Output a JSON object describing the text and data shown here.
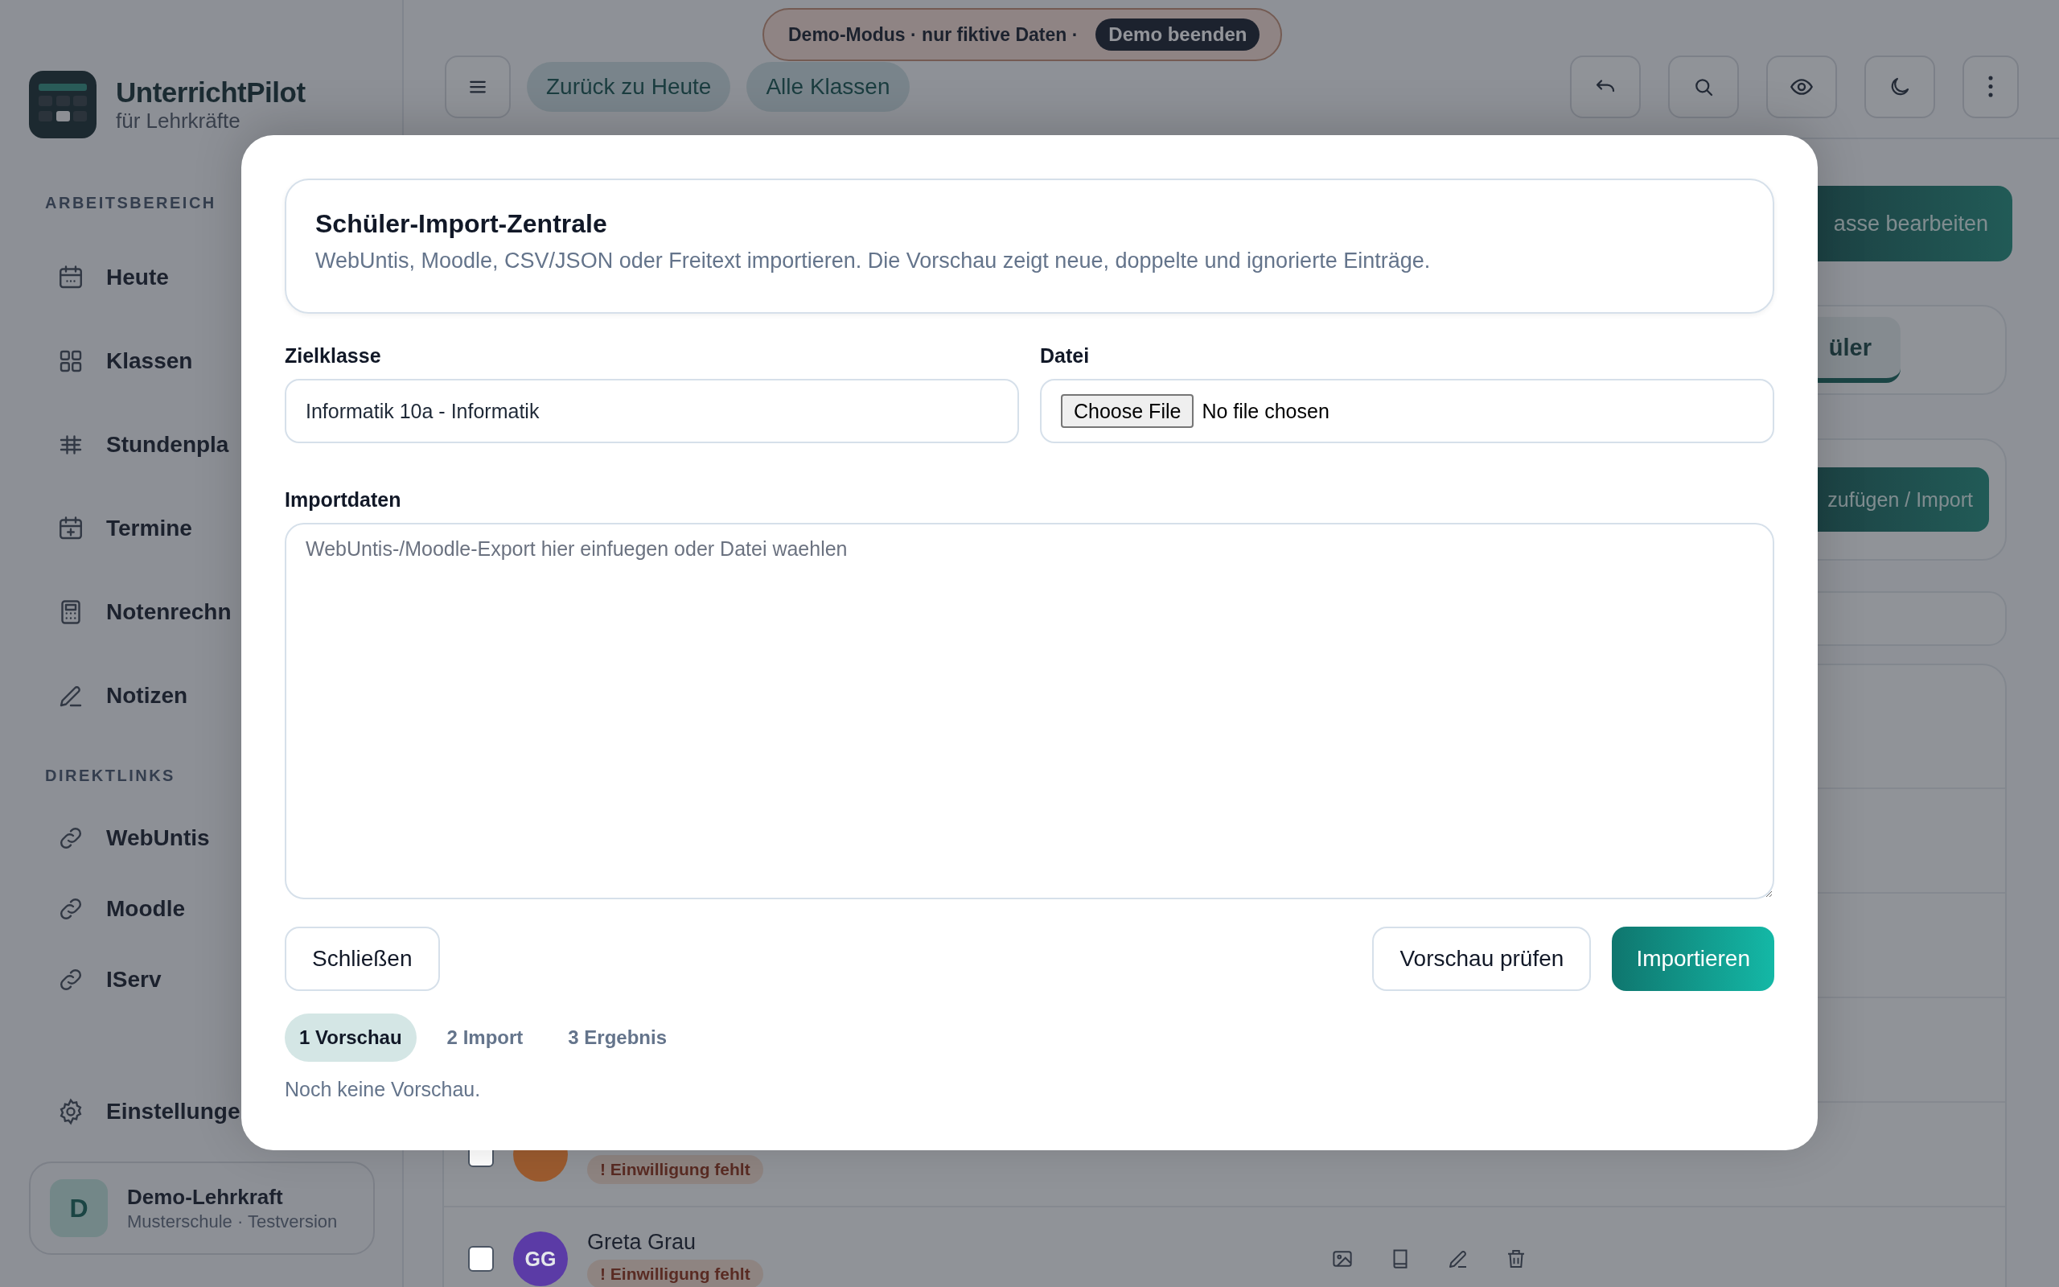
{
  "sidebar": {
    "app_name": "UnterrichtPilot",
    "app_subtitle": "für Lehrkräfte",
    "sections": [
      {
        "label": "ARBEITSBEREICH",
        "items": [
          {
            "label": "Heute"
          },
          {
            "label": "Klassen"
          },
          {
            "label": "Stundenpla"
          },
          {
            "label": "Termine"
          },
          {
            "label": "Notenrechn"
          },
          {
            "label": "Notizen"
          }
        ]
      },
      {
        "label": "DIREKTLINKS",
        "items": [
          {
            "label": "WebUntis"
          },
          {
            "label": "Moodle"
          },
          {
            "label": "IServ"
          }
        ]
      }
    ],
    "settings_label": "Einstellunge",
    "profile": {
      "initial": "D",
      "name": "Demo-Lehrkraft",
      "subtitle": "Musterschule · Testversion"
    }
  },
  "demo_banner": {
    "text": "Demo-Modus · nur fiktive Daten ·",
    "button": "Demo beenden"
  },
  "header": {
    "nav_pills": [
      "Zurück zu Heute",
      "Alle Klassen"
    ]
  },
  "background": {
    "edit_button": "asse bearbeiten",
    "tab": "üler",
    "add_button": "zufügen / Import",
    "rows": [
      {
        "checked": false,
        "color": "#9b5b2f",
        "badge": "! Einwilligung fehlt"
      },
      {
        "checked": false,
        "color": "#5b3ba6",
        "initials": "GG",
        "name": "Greta Grau",
        "badge": "! Einwilligung fehlt"
      }
    ]
  },
  "modal": {
    "title": "Schüler-Import-Zentrale",
    "description": "WebUntis, Moodle, CSV/JSON oder Freitext importieren. Die Vorschau zeigt neue, doppelte und ignorierte Einträge.",
    "target_label": "Zielklasse",
    "target_value": "Informatik 10a - Informatik",
    "file_label": "Datei",
    "file_button": "Choose File",
    "file_status": "No file chosen",
    "import_label": "Importdaten",
    "import_placeholder": "WebUntis-/Moodle-Export hier einfuegen oder Datei waehlen",
    "close_button": "Schließen",
    "preview_button": "Vorschau prüfen",
    "import_button": "Importieren",
    "steps": [
      {
        "label": "1 Vorschau",
        "selected": true
      },
      {
        "label": "2 Import",
        "selected": false
      },
      {
        "label": "3 Ergebnis",
        "selected": false
      }
    ],
    "status": "Noch keine Vorschau."
  }
}
